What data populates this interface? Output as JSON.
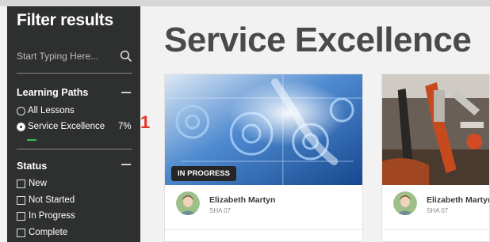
{
  "sidebar": {
    "title": "Filter results",
    "search": {
      "placeholder": "Start Typing Here...",
      "icon": "search-icon"
    },
    "learning_paths": {
      "heading": "Learning Paths",
      "options": [
        {
          "label": "All Lessons",
          "selected": false
        },
        {
          "label": "Service Excellence",
          "selected": true,
          "percent": "7%"
        }
      ]
    },
    "status": {
      "heading": "Status",
      "options": [
        "New",
        "Not Started",
        "In Progress",
        "Complete"
      ]
    }
  },
  "annotation": {
    "number": "1",
    "color": "#e8352c"
  },
  "main": {
    "title": "Service Excellence",
    "cards": [
      {
        "badge": "IN PROGRESS",
        "author": "Elizabeth Martyn",
        "code": "SHA 07",
        "image": "gears-hand-illustration"
      },
      {
        "author": "Elizabeth Martyn",
        "code": "SHA 07",
        "image": "tools-photo"
      }
    ]
  },
  "colors": {
    "sidebar_bg": "#2e2f2f",
    "accent_green": "#35c04a",
    "card_image_blue": "#1f5fb0"
  }
}
